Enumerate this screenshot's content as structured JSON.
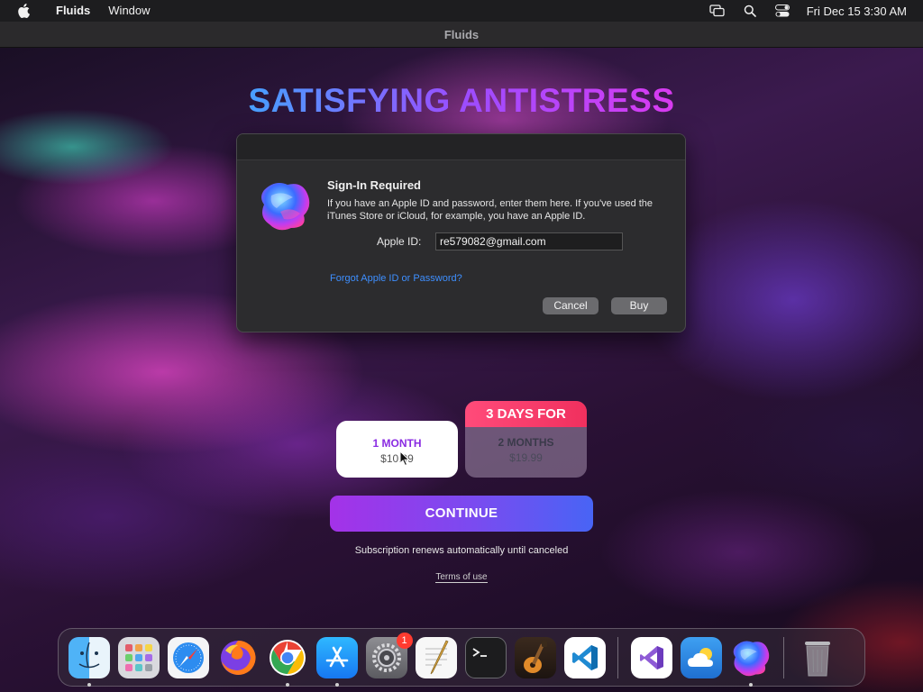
{
  "menubar": {
    "app_name": "Fluids",
    "menus": [
      "Window"
    ],
    "clock": "Fri Dec 15  3:30 AM"
  },
  "window": {
    "title": "Fluids"
  },
  "headline": "SATISFYING ANTISTRESS",
  "dialog": {
    "title": "Sign-In Required",
    "message": "If you have an Apple ID and password, enter them here. If you've used the iTunes Store or iCloud, for example, you have an Apple ID.",
    "apple_id_label": "Apple ID:",
    "apple_id_value": "re579082@gmail.com",
    "forgot_link": "Forgot Apple ID or Password?",
    "cancel_label": "Cancel",
    "buy_label": "Buy"
  },
  "plans": [
    {
      "name": "1 MONTH",
      "price": "$10.99",
      "selected": true
    },
    {
      "badge": "3 DAYS FOR",
      "name": "2 MONTHS",
      "price": "$19.99",
      "selected": false
    }
  ],
  "continue_label": "CONTINUE",
  "renew_text": "Subscription renews automatically until canceled",
  "terms_link": "Terms of use",
  "dock": {
    "apps": [
      {
        "name": "finder",
        "running": true
      },
      {
        "name": "launchpad",
        "running": false
      },
      {
        "name": "safari",
        "running": false
      },
      {
        "name": "firefox",
        "running": false
      },
      {
        "name": "chrome",
        "running": true
      },
      {
        "name": "app-store",
        "running": true
      },
      {
        "name": "system-settings",
        "running": false,
        "badge": "1"
      },
      {
        "name": "textedit",
        "running": false
      },
      {
        "name": "terminal",
        "running": false
      },
      {
        "name": "garageband",
        "running": false
      },
      {
        "name": "vscode",
        "running": false
      },
      {
        "name": "visual-studio",
        "running": false
      },
      {
        "name": "weather",
        "running": false
      },
      {
        "name": "fluids",
        "running": true
      },
      {
        "name": "trash",
        "running": false
      }
    ]
  },
  "colors": {
    "accent_gradient": [
      "#a432e8",
      "#4864f5"
    ],
    "badge_red": "#f0305e",
    "link_blue": "#3e8fff"
  }
}
